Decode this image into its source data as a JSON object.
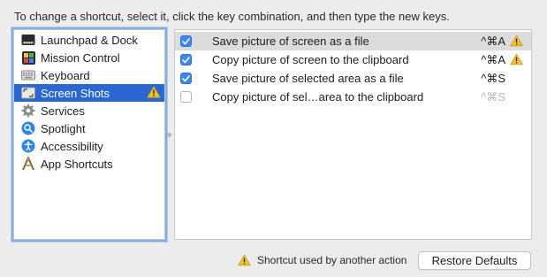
{
  "instruction": "To change a shortcut, select it, click the key combination, and then type the new keys.",
  "sidebar": {
    "items": [
      {
        "label": "Launchpad & Dock",
        "icon": "launchpad-icon"
      },
      {
        "label": "Mission Control",
        "icon": "mission-control-icon"
      },
      {
        "label": "Keyboard",
        "icon": "keyboard-icon"
      },
      {
        "label": "Screen Shots",
        "icon": "screenshot-icon",
        "selected": true,
        "warning": true
      },
      {
        "label": "Services",
        "icon": "gear-icon"
      },
      {
        "label": "Spotlight",
        "icon": "spotlight-icon"
      },
      {
        "label": "Accessibility",
        "icon": "accessibility-icon"
      },
      {
        "label": "App Shortcuts",
        "icon": "app-shortcuts-icon"
      }
    ]
  },
  "shortcuts": [
    {
      "checked": true,
      "label": "Save picture of screen as a file",
      "key": "^⌘A",
      "warning": true,
      "selected": true
    },
    {
      "checked": true,
      "label": "Copy picture of screen to the clipboard",
      "key": "^⌘A",
      "warning": true
    },
    {
      "checked": true,
      "label": "Save picture of selected area as a file",
      "key": "^⌘S"
    },
    {
      "checked": false,
      "label": "Copy picture of sel…area to the clipboard",
      "key": "^⌘S",
      "dim": true
    }
  ],
  "footer": {
    "warning_text": "Shortcut used by another action",
    "restore_label": "Restore Defaults"
  },
  "colors": {
    "selection": "#2a67d3",
    "checkbox": "#3b86f0",
    "warning": "#f2b61f"
  }
}
